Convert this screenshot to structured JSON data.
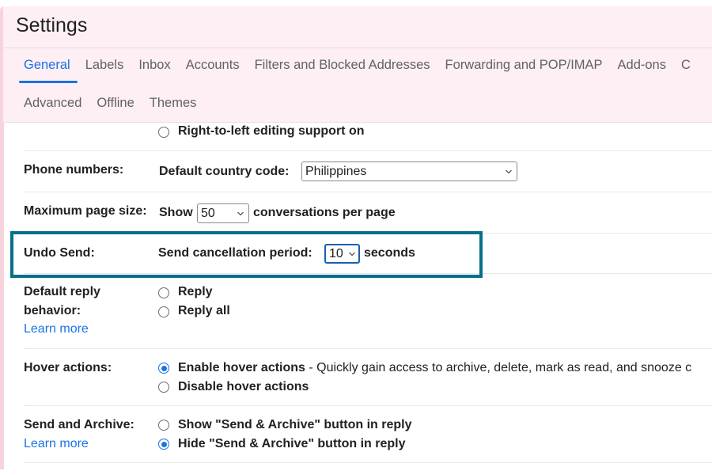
{
  "header": {
    "title": "Settings"
  },
  "tabs": {
    "row1": [
      {
        "label": "General",
        "active": true
      },
      {
        "label": "Labels"
      },
      {
        "label": "Inbox"
      },
      {
        "label": "Accounts"
      },
      {
        "label": "Filters and Blocked Addresses"
      },
      {
        "label": "Forwarding and POP/IMAP"
      },
      {
        "label": "Add-ons"
      },
      {
        "label": "C"
      }
    ],
    "row2": [
      {
        "label": "Advanced"
      },
      {
        "label": "Offline"
      },
      {
        "label": "Themes"
      }
    ]
  },
  "settings": {
    "rtl": {
      "option_on": "Right-to-left editing support on"
    },
    "phone": {
      "label": "Phone numbers:",
      "field_label": "Default country code:",
      "value": "Philippines"
    },
    "page_size": {
      "label": "Maximum page size:",
      "prefix": "Show",
      "value": "50",
      "suffix": "conversations per page"
    },
    "undo_send": {
      "label": "Undo Send:",
      "field_label": "Send cancellation period:",
      "value": "10",
      "suffix": "seconds"
    },
    "reply": {
      "label_line1": "Default reply",
      "label_line2": "behavior:",
      "learn_more": "Learn more",
      "options": [
        "Reply",
        "Reply all"
      ]
    },
    "hover": {
      "label": "Hover actions:",
      "enable": "Enable hover actions",
      "enable_desc": " - Quickly gain access to archive, delete, mark as read, and snooze c",
      "disable": "Disable hover actions",
      "selected": "enable"
    },
    "send_archive": {
      "label": "Send and Archive:",
      "learn_more": "Learn more",
      "show": "Show \"Send & Archive\" button in reply",
      "hide": "Hide \"Send & Archive\" button in reply",
      "selected": "hide"
    }
  },
  "colors": {
    "accent": "#1a73e8",
    "header_bg": "#fdeff3",
    "highlight_border": "#06708a"
  }
}
